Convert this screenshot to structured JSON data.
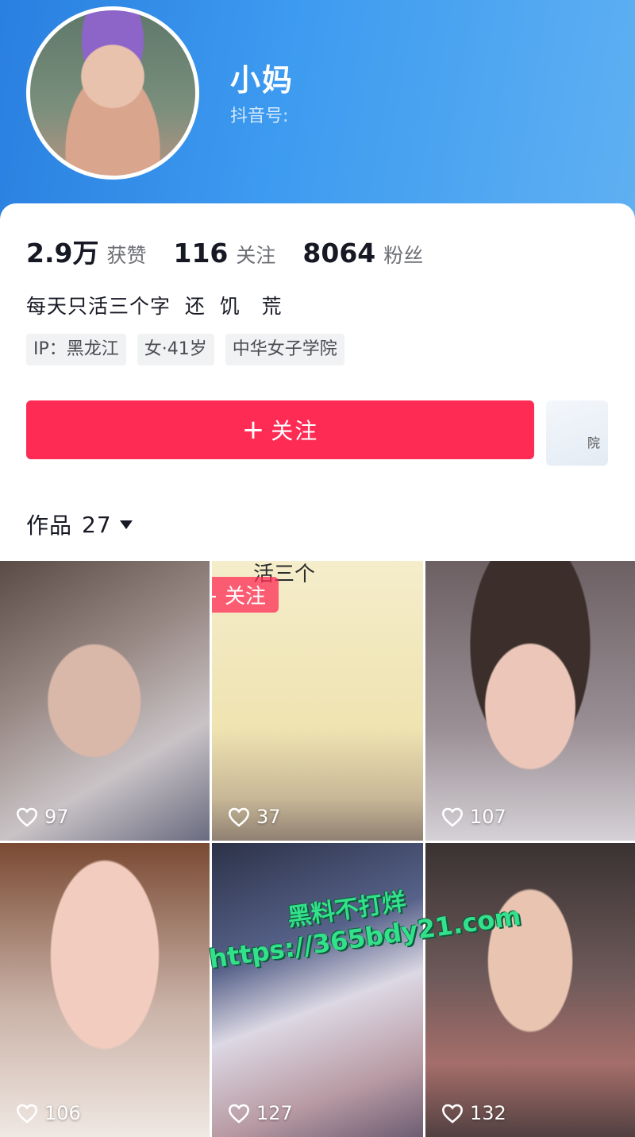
{
  "profile": {
    "username": "小妈",
    "account_label": "抖音号:",
    "stats": [
      {
        "value": "2.9万",
        "label": "获赞"
      },
      {
        "value": "116",
        "label": "关注"
      },
      {
        "value": "8064",
        "label": "粉丝"
      }
    ],
    "bio": "每天只活三个字  还  饥   荒",
    "tags": [
      "IP：黑龙江",
      "女·41岁",
      "中华女子学院"
    ],
    "follow_button": "关注",
    "side_button_text": "院"
  },
  "works": {
    "tab_label": "作品",
    "count": "27",
    "items": [
      {
        "likes": "97"
      },
      {
        "likes": "37",
        "overlay_title": "活三个",
        "overlay_follow": "+ 关注"
      },
      {
        "likes": "107"
      },
      {
        "likes": "106"
      },
      {
        "likes": "127"
      },
      {
        "likes": "132"
      }
    ]
  },
  "watermark": {
    "line1": "黑料不打烊",
    "line2": "https://365bdy21.com"
  },
  "colors": {
    "header_blue": "#2a7fe0",
    "follow_red": "#fe2c55",
    "watermark_green": "#33e08c"
  }
}
